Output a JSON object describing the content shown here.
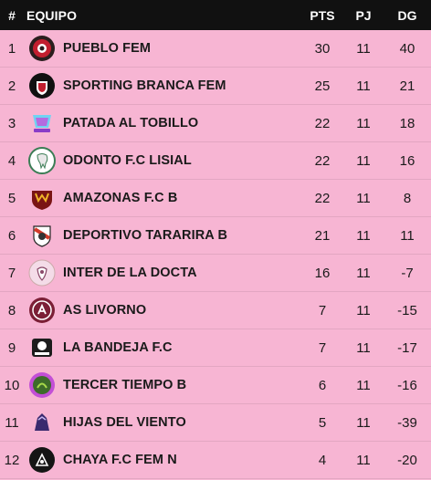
{
  "header": {
    "pos": "#",
    "team": "EQUIPO",
    "pts": "PTS",
    "pj": "PJ",
    "dg": "DG"
  },
  "rows": [
    {
      "pos": "1",
      "team": "PUEBLO FEM",
      "pts": "30",
      "pj": "11",
      "dg": "40",
      "logo": "pueblo-fem-crest-icon"
    },
    {
      "pos": "2",
      "team": "SPORTING BRANCA FEM",
      "pts": "25",
      "pj": "11",
      "dg": "21",
      "logo": "sporting-branca-crest-icon"
    },
    {
      "pos": "3",
      "team": "PATADA AL TOBILLO",
      "pts": "22",
      "pj": "11",
      "dg": "18",
      "logo": "patada-al-tobillo-crest-icon"
    },
    {
      "pos": "4",
      "team": "ODONTO F.C LISIAL",
      "pts": "22",
      "pj": "11",
      "dg": "16",
      "logo": "odonto-crest-icon"
    },
    {
      "pos": "5",
      "team": "AMAZONAS F.C B",
      "pts": "22",
      "pj": "11",
      "dg": "8",
      "logo": "amazonas-crest-icon"
    },
    {
      "pos": "6",
      "team": "DEPORTIVO TARARIRA B",
      "pts": "21",
      "pj": "11",
      "dg": "11",
      "logo": "deportivo-tararira-crest-icon"
    },
    {
      "pos": "7",
      "team": "INTER DE LA DOCTA",
      "pts": "16",
      "pj": "11",
      "dg": "-7",
      "logo": "inter-de-la-docta-crest-icon"
    },
    {
      "pos": "8",
      "team": "AS LIVORNO",
      "pts": "7",
      "pj": "11",
      "dg": "-15",
      "logo": "as-livorno-crest-icon"
    },
    {
      "pos": "9",
      "team": "LA BANDEJA F.C",
      "pts": "7",
      "pj": "11",
      "dg": "-17",
      "logo": "la-bandeja-crest-icon"
    },
    {
      "pos": "10",
      "team": "TERCER TIEMPO B",
      "pts": "6",
      "pj": "11",
      "dg": "-16",
      "logo": "tercer-tiempo-crest-icon"
    },
    {
      "pos": "11",
      "team": "HIJAS DEL VIENTO",
      "pts": "5",
      "pj": "11",
      "dg": "-39",
      "logo": "hijas-del-viento-crest-icon"
    },
    {
      "pos": "12",
      "team": "CHAYA F.C FEM N",
      "pts": "4",
      "pj": "11",
      "dg": "-20",
      "logo": "chaya-crest-icon"
    }
  ],
  "colors": {
    "background": "#f7b5d3",
    "header": "#111111"
  }
}
